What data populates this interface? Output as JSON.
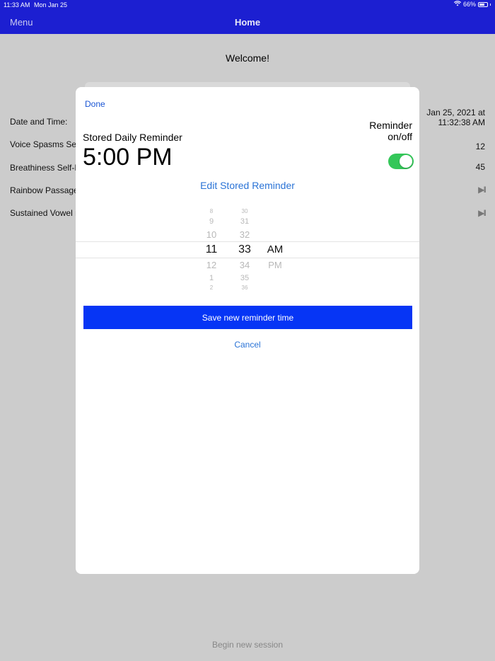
{
  "status_bar": {
    "time": "11:33 AM",
    "date": "Mon Jan 25",
    "battery": "66%"
  },
  "navbar": {
    "menu_label": "Menu",
    "title": "Home"
  },
  "welcome": "Welcome!",
  "background_rows": [
    {
      "label": "Date and Time:",
      "value": "Jan 25, 2021 at\n11:32:38 AM"
    },
    {
      "label": "Voice Spasms Sel",
      "value": "12"
    },
    {
      "label": "Breathiness Self-R",
      "value": "45"
    },
    {
      "label": "Rainbow Passage",
      "value": "▶︎II"
    },
    {
      "label": "Sustained Vowel r",
      "value": "▶︎II"
    }
  ],
  "begin_session_label": "Begin new session",
  "modal": {
    "done_label": "Done",
    "stored_label": "Stored Daily Reminder",
    "stored_time": "5:00 PM",
    "reminder_toggle_label": "Reminder on/off",
    "reminder_on": true,
    "edit_label": "Edit Stored Reminder",
    "picker": {
      "hours": [
        "8",
        "9",
        "10",
        "11",
        "12",
        "1",
        "2"
      ],
      "minutes": [
        "30",
        "31",
        "32",
        "33",
        "34",
        "35",
        "36"
      ],
      "ampm": [
        "AM",
        "PM"
      ],
      "selected": {
        "hour": "11",
        "minute": "33",
        "ampm": "AM"
      }
    },
    "save_label": "Save new reminder time",
    "cancel_label": "Cancel"
  },
  "colors": {
    "accent_nav": "#1c1fd1",
    "save_button": "#0635f5",
    "link": "#2a73d6",
    "toggle_on": "#34c759"
  }
}
